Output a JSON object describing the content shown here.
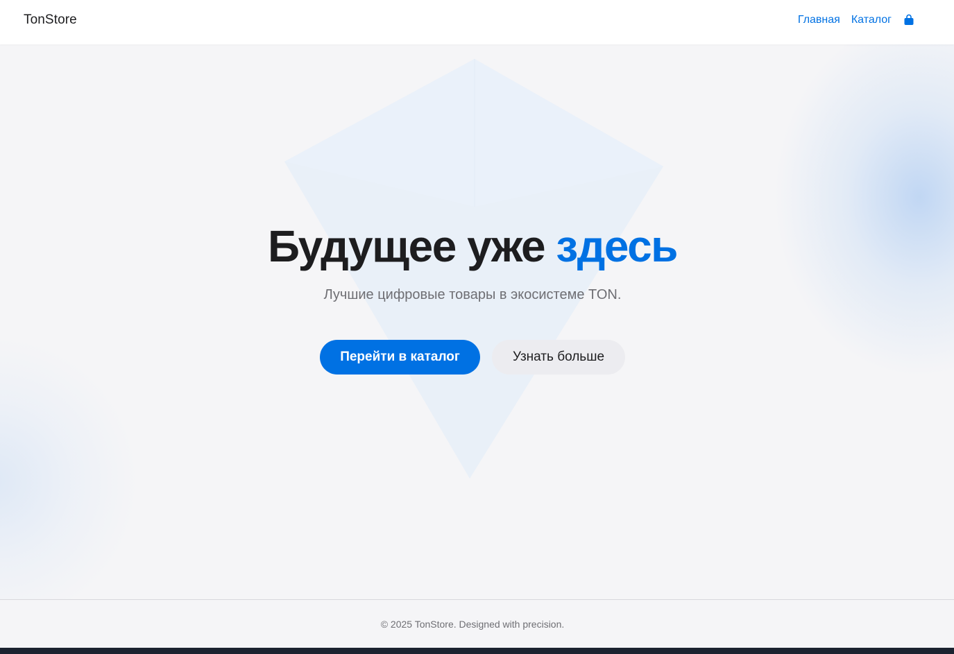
{
  "header": {
    "brand": "TonStore",
    "nav": {
      "home_label": "Главная",
      "catalog_label": "Каталог",
      "cart_icon": "shopping-bag-icon"
    }
  },
  "hero": {
    "title_main": "Будущее уже ",
    "title_accent": "здесь",
    "subtitle": "Лучшие цифровые товары в экосистеме TON.",
    "primary_button": "Перейти в каталог",
    "secondary_button": "Узнать больше",
    "background_shape": "ton-diamond-icon"
  },
  "footer": {
    "copyright": "© 2025 TonStore. Designed with precision."
  },
  "colors": {
    "accent": "#0071e3",
    "text": "#1d1d1f",
    "muted": "#6e6e73",
    "background": "#f5f5f7"
  }
}
